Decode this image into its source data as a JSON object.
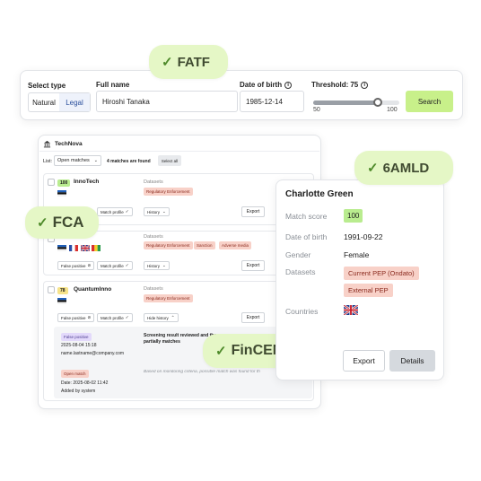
{
  "chips": {
    "fatf": "FATF",
    "amld": "6AMLD",
    "fca": "FCA",
    "fincen": "FinCEN",
    "check": "✓"
  },
  "search": {
    "select_type_label": "Select type",
    "type_natural": "Natural",
    "type_legal": "Legal",
    "full_name_label": "Full name",
    "full_name_value": "Hiroshi Tanaka",
    "dob_label": "Date of birth",
    "dob_value": "1985-12-14",
    "threshold_label": "Threshold:",
    "threshold_value": "75",
    "slider_min": "50",
    "slider_max": "100",
    "slider_fraction": 0.75,
    "search_button": "Search"
  },
  "panel": {
    "org": "TechNova",
    "list_label": "List:",
    "list_select": "Open matches",
    "count_text": "4 matches are found",
    "select_all": "Select all",
    "rows": [
      {
        "score": "100",
        "name": "InnoTech",
        "datasets_label": "Datasets",
        "tags": [
          "Regulatory Enforcement"
        ],
        "false_positive": "False positive",
        "match_profile": "Match profile",
        "history": "History",
        "export": "Export"
      },
      {
        "datasets_label": "Datasets",
        "tags": [
          "Regulatory Enforcement",
          "Sanction",
          "Adverse media"
        ],
        "false_positive": "False positive",
        "match_profile": "Match profile",
        "history": "History",
        "export": "Export"
      },
      {
        "score": "78",
        "name": "QuantumInno",
        "datasets_label": "Datasets",
        "tags": [
          "Regulatory Enforcement"
        ],
        "false_positive": "False positive",
        "match_profile": "Match profile",
        "history": "Hide history",
        "export": "Export",
        "history_items": [
          {
            "badge": "False positive",
            "date": "2025-08-04 15:18",
            "user": "name.lastname@company.com",
            "note": "Screening result reviewed and the name partially matches"
          },
          {
            "badge": "Open match",
            "date": "Date: 2025-08-02 11:42",
            "user": "Added by system",
            "note": "Based on monitoring criteria, possible match was found for th"
          }
        ]
      }
    ]
  },
  "detail": {
    "name": "Charlotte Green",
    "match_score_label": "Match score",
    "match_score": "100",
    "dob_label": "Date of birth",
    "dob": "1991-09-22",
    "gender_label": "Gender",
    "gender": "Female",
    "datasets_label": "Datasets",
    "datasets": [
      "Current PEP (Ondato)",
      "External PEP"
    ],
    "countries_label": "Countries",
    "export_button": "Export",
    "details_button": "Details"
  },
  "colors": {
    "accent_green": "#c8f08a",
    "chip_bg": "#e5f7c6",
    "tag_bg": "#f8d1c8",
    "tag_text": "#8a2a1e",
    "score_green": "#b9ec8f",
    "score_yellow": "#f6e38a",
    "badge_purple": "#e3d9fb",
    "badge_red": "#f8d1c8"
  }
}
